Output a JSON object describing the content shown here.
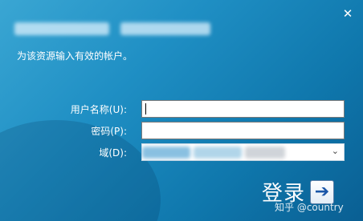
{
  "window": {
    "close_glyph": "✕"
  },
  "header": {
    "subtitle": "为该资源输入有效的帐户。"
  },
  "form": {
    "username_label": "用户名称(U):",
    "username_value": "",
    "password_label": "密码(P):",
    "password_value": "",
    "domain_label": "域(D):",
    "domain_chevron": "⌄"
  },
  "actions": {
    "login_label": "登录",
    "login_arrow": "➔"
  },
  "watermark": {
    "text": "知乎 @country"
  },
  "colors": {
    "background_accent": "#1f8fc4",
    "button_arrow": "#1a56a8"
  },
  "icons": {
    "close": "close-icon",
    "arrow": "arrow-right-icon",
    "chevron": "chevron-down-icon"
  }
}
